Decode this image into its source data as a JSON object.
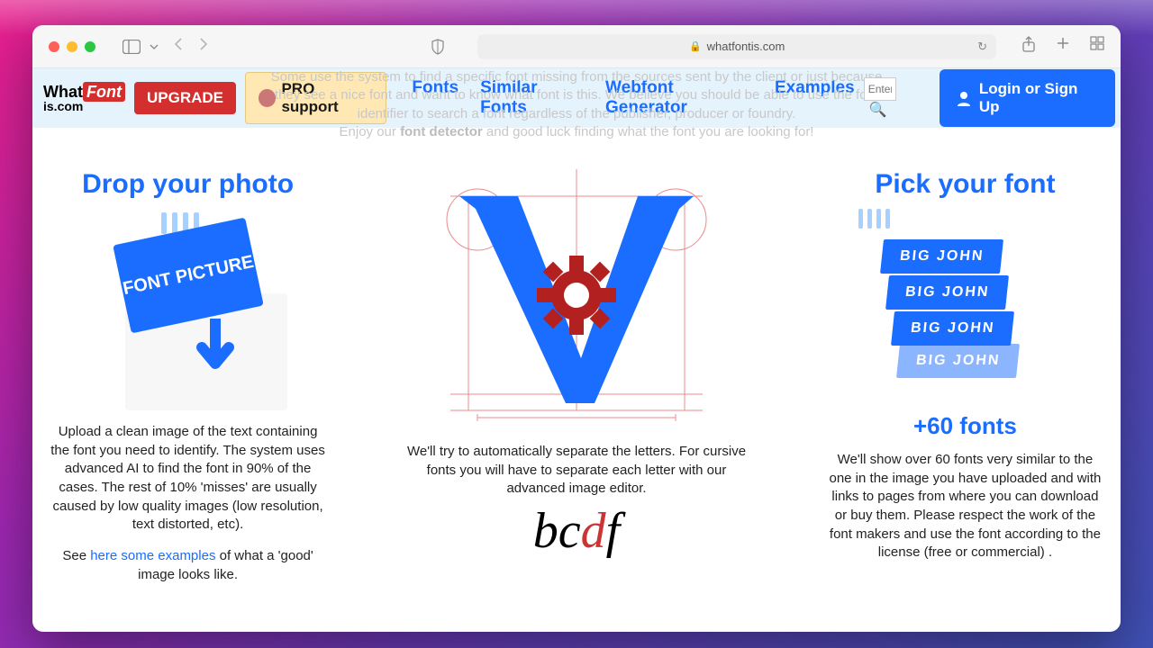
{
  "browser": {
    "url": "whatfontis.com"
  },
  "header": {
    "logo_top_a": "What",
    "logo_top_b": "Font",
    "logo_bot": "is.com",
    "upgrade": "UPGRADE",
    "pro": "PRO support",
    "nav": {
      "fonts": "Fonts",
      "similar": "Similar Fonts",
      "webfont": "Webfont Generator",
      "examples": "Examples"
    },
    "search_placeholder": "Enter",
    "login": "Login or Sign Up"
  },
  "intro": {
    "line1": "Some use the system to find a specific font missing from the sources sent by the client or just because they see a nice font and want to know what font is this. We believe you should be able to use the font identifier to search a font regardless of the publisher, producer or foundry.",
    "enjoy_a": "Enjoy our ",
    "enjoy_b": "font detector",
    "enjoy_c": " and good luck finding what the font you are looking for!"
  },
  "col1": {
    "title": "Drop your photo",
    "badge": "FONT PICTURE",
    "p1": "Upload a clean image of the text containing the font you need to identify. The system uses advanced AI to find the font in 90% of the cases. The rest of 10% 'misses' are usually caused by low quality images (low resolution, text distorted, etc).",
    "p2a": "See ",
    "p2link": "here some examples",
    "p2b": " of what a 'good' image looks like."
  },
  "col2": {
    "text": "We'll try to automatically separate the letters. For cursive fonts you will have to separate each letter with our advanced image editor.",
    "script_a": "bc",
    "script_b": "d",
    "script_c": "f"
  },
  "col3": {
    "title": "Pick your font",
    "card": "BIG JOHN",
    "sub": "+60 fonts",
    "text": "We'll show over 60 fonts very similar to the one in the image you have uploaded and with links to pages from where you can download or buy them. Please respect the work of the font makers and use the font according to the license (free or commercial) ."
  }
}
